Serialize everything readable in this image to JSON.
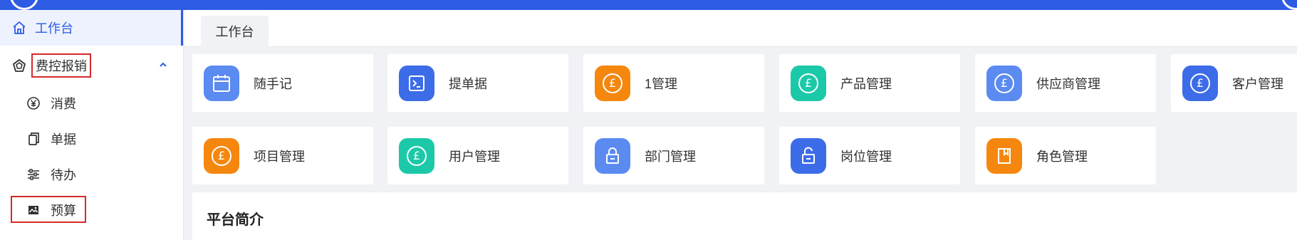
{
  "colors": {
    "brand": "#2d5be3",
    "highlight_box": "#d62a2a",
    "blue": "#3d6ce8",
    "blue_light": "#5b8af0",
    "orange": "#f5870f",
    "teal": "#1bc9a9"
  },
  "sidebar": {
    "home": {
      "label": "工作台",
      "icon": "home-icon"
    },
    "group": {
      "label": "费控报销",
      "icon": "pentagon-icon",
      "expanded": true
    },
    "items": [
      {
        "label": "消费",
        "icon": "yen-circle-icon"
      },
      {
        "label": "单据",
        "icon": "copy-icon"
      },
      {
        "label": "待办",
        "icon": "sliders-icon"
      },
      {
        "label": "预算",
        "icon": "image-icon"
      }
    ]
  },
  "tabs": [
    {
      "label": "工作台",
      "active": true
    }
  ],
  "shortcuts": [
    {
      "label": "随手记",
      "icon": "calendar-icon",
      "color": "#5b8af0"
    },
    {
      "label": "提单据",
      "icon": "terminal-icon",
      "color": "#3d6ce8"
    },
    {
      "label": "1管理",
      "icon": "pound-coin-icon",
      "color": "#f5870f"
    },
    {
      "label": "产品管理",
      "icon": "pound-coin-icon",
      "color": "#1bc9a9"
    },
    {
      "label": "供应商管理",
      "icon": "pound-coin-icon",
      "color": "#5b8af0"
    },
    {
      "label": "客户管理",
      "icon": "pound-coin-icon",
      "color": "#3d6ce8"
    },
    {
      "label": "项目管理",
      "icon": "pound-coin-icon",
      "color": "#f5870f"
    },
    {
      "label": "用户管理",
      "icon": "pound-coin-icon",
      "color": "#1bc9a9"
    },
    {
      "label": "部门管理",
      "icon": "lock-icon",
      "color": "#5b8af0"
    },
    {
      "label": "岗位管理",
      "icon": "unlock-icon",
      "color": "#3d6ce8"
    },
    {
      "label": "角色管理",
      "icon": "bookmark-icon",
      "color": "#f5870f"
    }
  ],
  "intro": {
    "title": "平台简介"
  }
}
